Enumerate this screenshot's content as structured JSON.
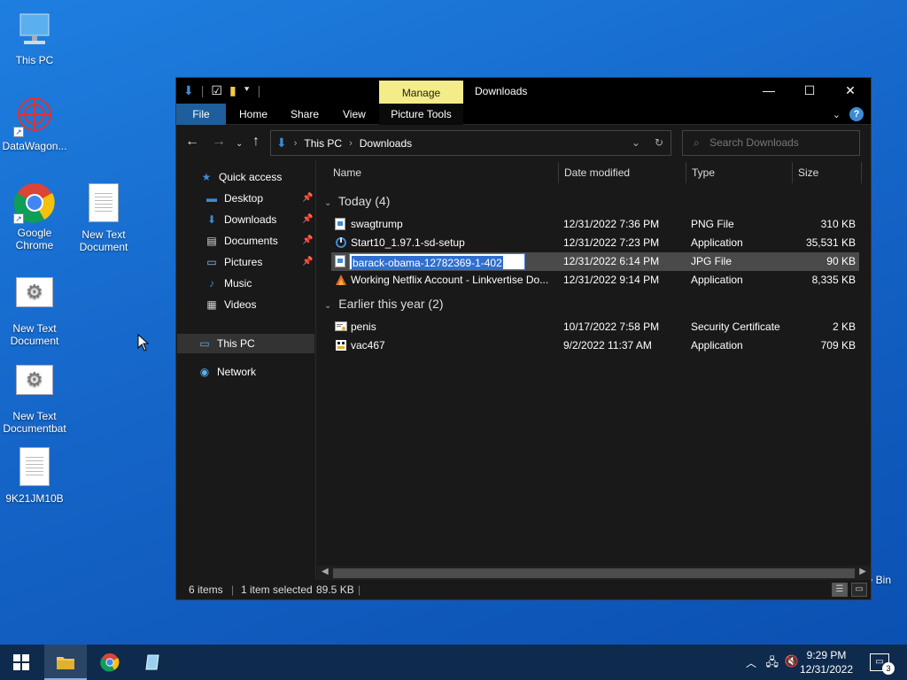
{
  "desktop": {
    "icons": [
      {
        "label": "This PC"
      },
      {
        "label": "DataWagon..."
      },
      {
        "label": "Google Chrome"
      },
      {
        "label": "New Text Document"
      },
      {
        "label": "New Text Document"
      },
      {
        "label": "New Text Documentbat"
      },
      {
        "label": "9K21JM10B"
      },
      {
        "label": "e Bin"
      }
    ]
  },
  "window": {
    "title": "Downloads",
    "context_tab": "Manage",
    "ribbon_tabs": [
      "File",
      "Home",
      "Share",
      "View",
      "Picture Tools"
    ],
    "address": {
      "crumbs": [
        "This PC",
        "Downloads"
      ]
    },
    "search_placeholder": "Search Downloads",
    "nav": {
      "quick_access": "Quick access",
      "items": [
        {
          "label": "Desktop",
          "pinned": true
        },
        {
          "label": "Downloads",
          "pinned": true
        },
        {
          "label": "Documents",
          "pinned": true
        },
        {
          "label": "Pictures",
          "pinned": true
        },
        {
          "label": "Music",
          "pinned": false
        },
        {
          "label": "Videos",
          "pinned": false
        }
      ],
      "this_pc": "This PC",
      "network": "Network"
    },
    "columns": [
      "Name",
      "Date modified",
      "Type",
      "Size"
    ],
    "groups": [
      {
        "header": "Today (4)",
        "rows": [
          {
            "name": "swagtrump",
            "date": "12/31/2022 7:36 PM",
            "type": "PNG File",
            "size": "310 KB"
          },
          {
            "name": "Start10_1.97.1-sd-setup",
            "date": "12/31/2022 7:23 PM",
            "type": "Application",
            "size": "35,531 KB"
          },
          {
            "name": "barack-obama-12782369-1-402",
            "date": "12/31/2022 6:14 PM",
            "type": "JPG File",
            "size": "90 KB"
          },
          {
            "name": "Working Netflix Account - Linkvertise Do...",
            "date": "12/31/2022 9:14 PM",
            "type": "Application",
            "size": "8,335 KB"
          }
        ]
      },
      {
        "header": "Earlier this year (2)",
        "rows": [
          {
            "name": "penis",
            "date": "10/17/2022 7:58 PM",
            "type": "Security Certificate",
            "size": "2 KB"
          },
          {
            "name": "vac467",
            "date": "9/2/2022 11:37 AM",
            "type": "Application",
            "size": "709 KB"
          }
        ]
      }
    ],
    "status": {
      "items": "6 items",
      "selected": "1 item selected",
      "size": "89.5 KB"
    }
  },
  "taskbar": {
    "time": "9:29 PM",
    "date": "12/31/2022",
    "notification_count": "3"
  }
}
